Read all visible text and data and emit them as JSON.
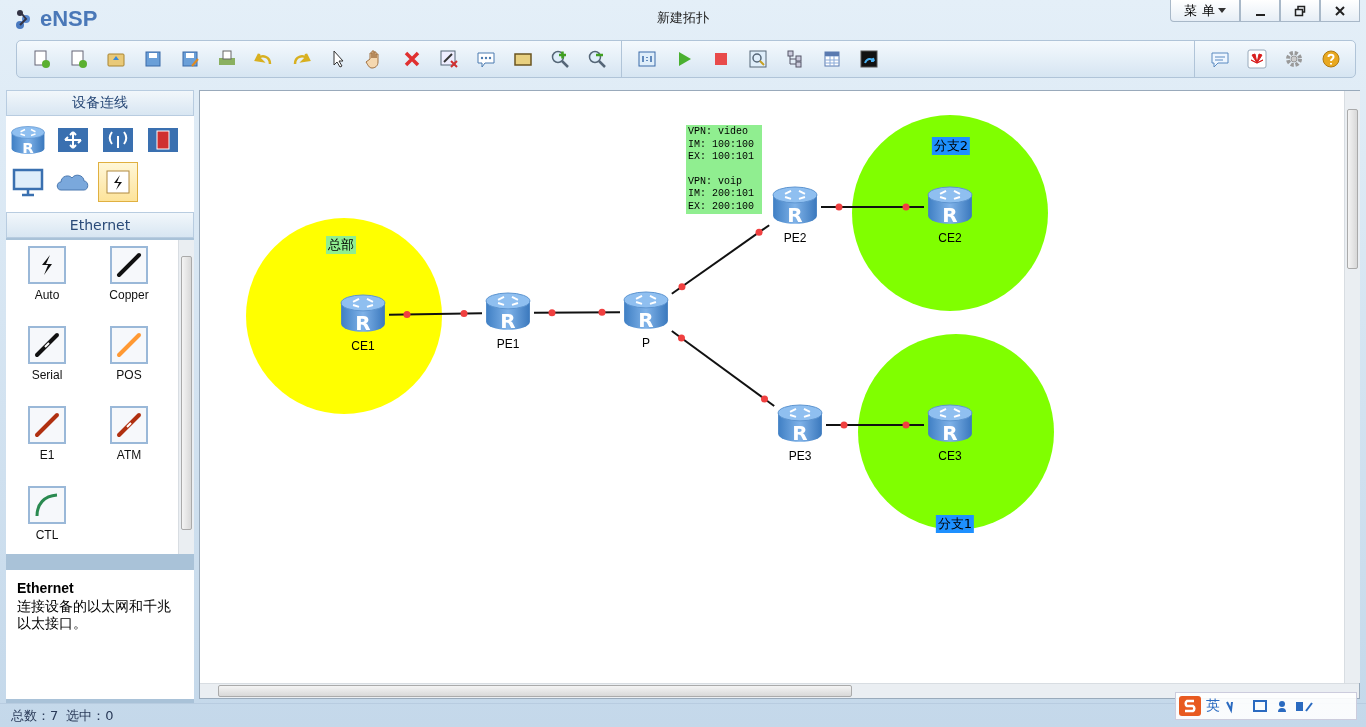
{
  "window": {
    "app_name": "eNSP",
    "title": "新建拓扑",
    "menu": "菜 单"
  },
  "device_panel": {
    "title": "设备连线",
    "categories": [
      {
        "glyph": "R",
        "selected": false
      },
      {
        "selected": false
      },
      {
        "selected": false
      },
      {
        "selected": false
      },
      {
        "selected": false
      },
      {
        "selected": false
      },
      {
        "selected": true
      }
    ]
  },
  "cable_panel": {
    "title": "Ethernet",
    "cables": [
      {
        "label": "Auto"
      },
      {
        "label": "Copper"
      },
      {
        "label": "Serial"
      },
      {
        "label": "POS"
      },
      {
        "label": "E1"
      },
      {
        "label": "ATM"
      },
      {
        "label": "CTL"
      }
    ]
  },
  "info_panel": {
    "title": "Ethernet",
    "description": "连接设备的以太网和千兆以太接口。"
  },
  "topology": {
    "areas": [
      {
        "label": "总部",
        "color": "#ffff00"
      },
      {
        "label": "分支2",
        "color": "#80ff00"
      },
      {
        "label": "分支1",
        "color": "#80ff00"
      }
    ],
    "nodes": [
      {
        "label": "CE1",
        "glyph": "R"
      },
      {
        "label": "PE1",
        "glyph": "R"
      },
      {
        "label": "P",
        "glyph": "R"
      },
      {
        "label": "PE2",
        "glyph": "R"
      },
      {
        "label": "CE2",
        "glyph": "R"
      },
      {
        "label": "PE3",
        "glyph": "R"
      },
      {
        "label": "CE3",
        "glyph": "R"
      }
    ],
    "note": {
      "blocks": [
        [
          "VPN: video",
          "IM: 100:100",
          "EX: 100:101"
        ],
        [
          "VPN: voip",
          "IM: 200:101",
          "EX: 200:100"
        ]
      ]
    }
  },
  "status_bar": {
    "total": "总数：7",
    "selected": "选中：0"
  },
  "ime_toolbar": {
    "mode": "英"
  }
}
